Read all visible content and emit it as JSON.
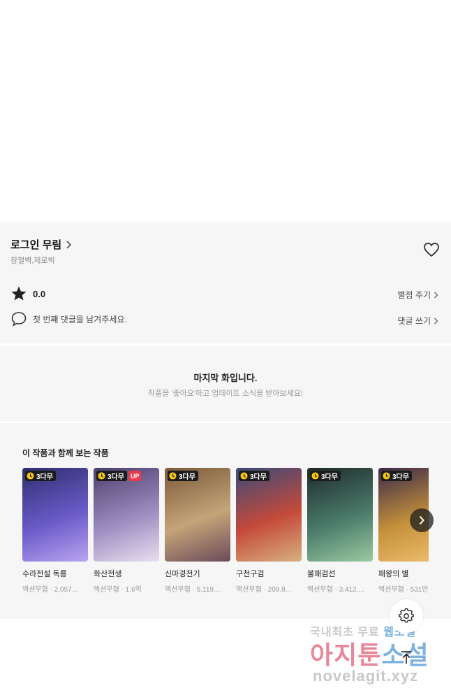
{
  "work": {
    "title": "로그인 무림",
    "authors": "장철벽,제로빅",
    "rating": "0.0",
    "rate_link": "별점 주기",
    "comment_prompt": "첫 번째 댓글을 남겨주세요.",
    "comment_link": "댓글 쓰기"
  },
  "last_episode": {
    "title": "마지막 화입니다.",
    "subtitle": "작품을 '좋아요'하고 업데이트 소식을 받아보세요!"
  },
  "recommendations": {
    "heading": "이 작품과 함께 보는 작품",
    "free_badge": "3다무",
    "up_badge": "UP",
    "items": [
      {
        "name": "수라전설 독룡",
        "meta": "액션무협 · 2,057...",
        "up": false,
        "colors": [
          "#2d2f6e",
          "#6a5ac8",
          "#b9a4f0"
        ]
      },
      {
        "name": "화산전생",
        "meta": "액션무협 · 1.6억",
        "up": true,
        "colors": [
          "#4b3f6b",
          "#9d8cc0",
          "#e8dff0"
        ]
      },
      {
        "name": "신마경천기",
        "meta": "액션무협 · 5,119....",
        "up": false,
        "colors": [
          "#7a5a3a",
          "#c4a478",
          "#6b4a5a"
        ]
      },
      {
        "name": "구천구검",
        "meta": "액션무협 · 209.8...",
        "up": false,
        "colors": [
          "#3a4a7a",
          "#c44a3a",
          "#d8b080"
        ]
      },
      {
        "name": "불패검선",
        "meta": "액션무협 · 3,412....",
        "up": false,
        "colors": [
          "#1e2a2a",
          "#4a7a6a",
          "#9acaa0"
        ]
      },
      {
        "name": "패왕의 별",
        "meta": "액션무협 · 531만",
        "up": false,
        "colors": [
          "#3a2a4a",
          "#c4903a",
          "#f0c070"
        ]
      }
    ]
  },
  "watermark": {
    "line1_a": "국내최초 무료 ",
    "line1_b": "웹소설",
    "line2_a": "아지툰",
    "line2_b": "소설",
    "line3": "novelagit.xyz"
  }
}
